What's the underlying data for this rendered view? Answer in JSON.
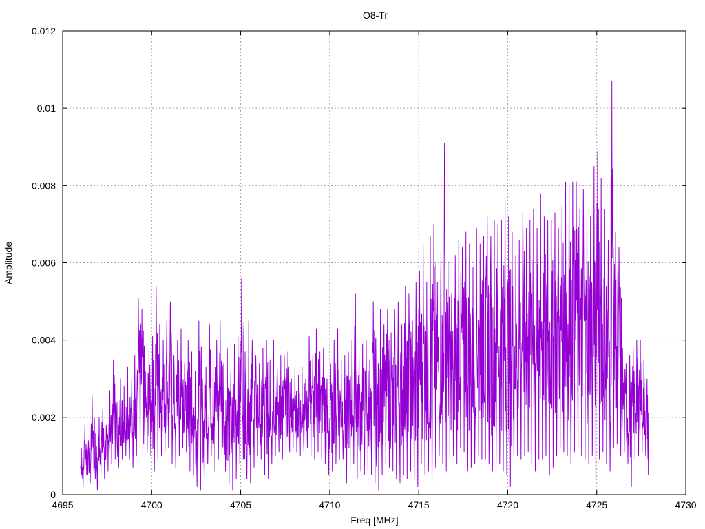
{
  "chart_data": {
    "type": "line",
    "title": "O8-Tr",
    "xlabel": "Freq [MHz]",
    "ylabel": "Amplitude",
    "xlim": [
      4695,
      4730
    ],
    "ylim": [
      0,
      0.012
    ],
    "x_ticks": [
      4695,
      4700,
      4705,
      4710,
      4715,
      4720,
      4725,
      4730
    ],
    "y_ticks": [
      0,
      0.002,
      0.004,
      0.006,
      0.008,
      0.01,
      0.012
    ],
    "x_tick_labels": [
      "4695",
      "4700",
      "4705",
      "4710",
      "4715",
      "4720",
      "4725",
      "4730"
    ],
    "y_tick_labels": [
      "0",
      "0.002",
      "0.004",
      "0.006",
      "0.008",
      "0.01",
      "0.012"
    ],
    "grid": true,
    "series": [
      {
        "color": "#9400d3",
        "x": [
          4696.0,
          4696.2,
          4696.4,
          4696.6,
          4696.8,
          4697.0,
          4697.2,
          4697.4,
          4697.6,
          4697.8,
          4698.0,
          4698.2,
          4698.4,
          4698.6,
          4698.8,
          4699.0,
          4699.2,
          4699.4,
          4699.6,
          4699.8,
          4700.0,
          4700.2,
          4700.4,
          4700.6,
          4700.8,
          4701.0,
          4701.2,
          4701.4,
          4701.6,
          4701.8,
          4702.0,
          4702.2,
          4702.4,
          4702.6,
          4702.8,
          4703.0,
          4703.2,
          4703.4,
          4703.6,
          4703.8,
          4704.0,
          4704.2,
          4704.4,
          4704.6,
          4704.8,
          4705.0,
          4705.2,
          4705.4,
          4705.6,
          4705.8,
          4706.0,
          4706.2,
          4706.4,
          4706.6,
          4706.8,
          4707.0,
          4707.2,
          4707.4,
          4707.6,
          4707.8,
          4708.0,
          4708.2,
          4708.4,
          4708.6,
          4708.8,
          4709.0,
          4709.2,
          4709.4,
          4709.6,
          4709.8,
          4710.0,
          4710.2,
          4710.4,
          4710.6,
          4710.8,
          4711.0,
          4711.2,
          4711.4,
          4711.6,
          4711.8,
          4712.0,
          4712.2,
          4712.4,
          4712.6,
          4712.8,
          4713.0,
          4713.2,
          4713.4,
          4713.6,
          4713.8,
          4714.0,
          4714.2,
          4714.4,
          4714.6,
          4714.8,
          4715.0,
          4715.2,
          4715.4,
          4715.6,
          4715.8,
          4716.0,
          4716.2,
          4716.4,
          4716.6,
          4716.8,
          4717.0,
          4717.2,
          4717.4,
          4717.6,
          4717.8,
          4718.0,
          4718.2,
          4718.4,
          4718.6,
          4718.8,
          4719.0,
          4719.2,
          4719.4,
          4719.6,
          4719.8,
          4720.0,
          4720.2,
          4720.4,
          4720.6,
          4720.8,
          4721.0,
          4721.2,
          4721.4,
          4721.6,
          4721.8,
          4722.0,
          4722.2,
          4722.4,
          4722.6,
          4722.8,
          4723.0,
          4723.2,
          4723.4,
          4723.6,
          4723.8,
          4724.0,
          4724.2,
          4724.4,
          4724.6,
          4724.8,
          4725.0,
          4725.2,
          4725.4,
          4725.6,
          4725.8,
          4726.0,
          4726.2,
          4726.4,
          4726.6,
          4726.8,
          4727.0,
          4727.2,
          4727.4,
          4727.6,
          4727.8,
          4727.9
        ],
        "y_max": [
          0.0012,
          0.0018,
          0.0014,
          0.0026,
          0.0016,
          0.002,
          0.0022,
          0.0018,
          0.0027,
          0.0035,
          0.0024,
          0.003,
          0.0028,
          0.0033,
          0.003,
          0.0036,
          0.0051,
          0.0048,
          0.0032,
          0.0038,
          0.0041,
          0.0054,
          0.0044,
          0.004,
          0.0045,
          0.005,
          0.0036,
          0.004,
          0.0043,
          0.0034,
          0.004,
          0.0037,
          0.0032,
          0.0045,
          0.003,
          0.0033,
          0.0044,
          0.0038,
          0.004,
          0.0045,
          0.0034,
          0.0038,
          0.0032,
          0.0039,
          0.0041,
          0.0056,
          0.0037,
          0.0045,
          0.004,
          0.0036,
          0.0034,
          0.0038,
          0.004,
          0.0035,
          0.004,
          0.0033,
          0.0036,
          0.0036,
          0.0037,
          0.003,
          0.0033,
          0.0031,
          0.0033,
          0.003,
          0.0041,
          0.0036,
          0.0043,
          0.0037,
          0.0038,
          0.003,
          0.0034,
          0.004,
          0.0043,
          0.0035,
          0.0036,
          0.0037,
          0.004,
          0.0052,
          0.0037,
          0.0039,
          0.004,
          0.0035,
          0.005,
          0.0041,
          0.0048,
          0.0044,
          0.0048,
          0.0042,
          0.0048,
          0.005,
          0.0044,
          0.0054,
          0.0052,
          0.0045,
          0.0055,
          0.0058,
          0.0065,
          0.0055,
          0.0067,
          0.007,
          0.0055,
          0.0064,
          0.0091,
          0.006,
          0.0052,
          0.0062,
          0.0066,
          0.0064,
          0.0068,
          0.0065,
          0.0059,
          0.0069,
          0.0065,
          0.0067,
          0.0072,
          0.0067,
          0.0071,
          0.007,
          0.0071,
          0.0077,
          0.0072,
          0.0068,
          0.0062,
          0.0066,
          0.0073,
          0.0069,
          0.0071,
          0.0074,
          0.0069,
          0.0078,
          0.0072,
          0.0071,
          0.0071,
          0.0073,
          0.0069,
          0.0075,
          0.0081,
          0.008,
          0.0081,
          0.0081,
          0.0074,
          0.0079,
          0.0077,
          0.0072,
          0.0085,
          0.0089,
          0.0082,
          0.0074,
          0.0066,
          0.0107,
          0.0068,
          0.0064,
          0.0038,
          0.0034,
          0.0036,
          0.0038,
          0.004,
          0.004,
          0.0035,
          0.003,
          0.0035
        ],
        "y_min": [
          0.0002,
          0.0005,
          0.0003,
          0.0006,
          0.0001,
          0.0005,
          0.0004,
          0.0006,
          0.0008,
          0.0009,
          0.0007,
          0.0009,
          0.001,
          0.0009,
          0.0007,
          0.001,
          0.0012,
          0.0013,
          0.0011,
          0.001,
          0.0006,
          0.0009,
          0.001,
          0.0011,
          0.0012,
          0.0008,
          0.0007,
          0.001,
          0.0012,
          0.0011,
          0.0006,
          0.0005,
          0.0002,
          0.0001,
          0.0004,
          0.0008,
          0.001,
          0.0006,
          0.0009,
          0.0011,
          0.0006,
          0.0003,
          0.0001,
          0.0004,
          0.0008,
          0.0009,
          0.0004,
          0.0003,
          0.0007,
          0.001,
          0.0009,
          0.0005,
          0.0004,
          0.0008,
          0.001,
          0.0011,
          0.0009,
          0.0009,
          0.0011,
          0.0012,
          0.0011,
          0.001,
          0.0011,
          0.0012,
          0.001,
          0.0009,
          0.0011,
          0.0009,
          0.0008,
          0.0005,
          0.0006,
          0.0008,
          0.0009,
          0.0009,
          0.0003,
          0.0006,
          0.0008,
          0.0004,
          0.0006,
          0.0005,
          0.0006,
          0.0005,
          0.0003,
          0.0001,
          0.0005,
          0.0008,
          0.0007,
          0.0006,
          0.0004,
          0.0003,
          0.0005,
          0.0004,
          0.0006,
          0.0004,
          0.0002,
          0.0008,
          0.0005,
          0.0006,
          0.0002,
          0.0007,
          0.001,
          0.0008,
          0.0006,
          0.0009,
          0.001,
          0.0008,
          0.0012,
          0.0011,
          0.0006,
          0.0007,
          0.0008,
          0.001,
          0.0009,
          0.0009,
          0.0008,
          0.0006,
          0.0008,
          0.0008,
          0.0006,
          0.0005,
          0.0002,
          0.0008,
          0.001,
          0.0009,
          0.001,
          0.0011,
          0.0008,
          0.0006,
          0.0009,
          0.0009,
          0.001,
          0.0005,
          0.0007,
          0.001,
          0.0012,
          0.0011,
          0.001,
          0.0008,
          0.0011,
          0.0012,
          0.001,
          0.0009,
          0.0008,
          0.001,
          0.0004,
          0.0009,
          0.0011,
          0.0008,
          0.0006,
          0.0012,
          0.0013,
          0.001,
          0.0011,
          0.0008,
          0.0002,
          0.0009,
          0.001,
          0.0011,
          0.001,
          0.0009,
          0.0005
        ]
      }
    ]
  }
}
